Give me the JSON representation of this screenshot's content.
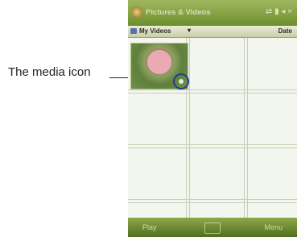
{
  "annotation": {
    "label": "The media icon"
  },
  "titlebar": {
    "title": "Pictures & Videos",
    "status": "⇄ ▮ ◂ ×"
  },
  "subbar": {
    "folder_label": "My Videos",
    "folder_arrow": "▾",
    "sort_label": "Date"
  },
  "bottombar": {
    "left_softkey": "Play",
    "right_softkey": "Menu"
  }
}
